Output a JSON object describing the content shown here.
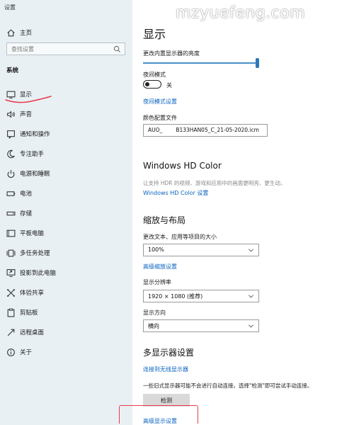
{
  "window": {
    "title": "设置"
  },
  "watermark": "mzyuefeng.com",
  "sidebar": {
    "home": "主页",
    "search_placeholder": "查找设置",
    "section": "系统",
    "items": [
      {
        "label": "显示",
        "icon": "monitor-icon"
      },
      {
        "label": "声音",
        "icon": "speaker-icon"
      },
      {
        "label": "通知和操作",
        "icon": "notification-icon"
      },
      {
        "label": "专注助手",
        "icon": "moon-icon"
      },
      {
        "label": "电源和睡眠",
        "icon": "power-icon"
      },
      {
        "label": "电池",
        "icon": "battery-icon"
      },
      {
        "label": "存储",
        "icon": "storage-icon"
      },
      {
        "label": "平板电脑",
        "icon": "tablet-icon"
      },
      {
        "label": "多任务处理",
        "icon": "multitask-icon"
      },
      {
        "label": "投影到此电脑",
        "icon": "project-icon"
      },
      {
        "label": "体验共享",
        "icon": "share-icon"
      },
      {
        "label": "剪贴板",
        "icon": "clipboard-icon"
      },
      {
        "label": "远程桌面",
        "icon": "remote-desktop-icon"
      },
      {
        "label": "关于",
        "icon": "info-icon"
      }
    ]
  },
  "main": {
    "title": "显示",
    "brightness_label": "更改内置显示器的亮度",
    "brightness_value": 100,
    "night_mode_label": "夜间模式",
    "night_mode_state": "关",
    "night_mode_settings_link": "夜间模式设置",
    "color_profile_label": "颜色配置文件",
    "color_profile_value": "AUO_        B133HAN05_C_21-05-2020.icm",
    "hd_title": "Windows HD Color",
    "hd_desc": "让支持 HDR 的视频、游戏和应用中的画面更明亮、更生动。",
    "hd_link": "Windows HD Color 设置",
    "scale_title": "缩放与布局",
    "scale_label": "更改文本、应用等项目的大小",
    "scale_value": "100%",
    "advanced_scale_link": "高级缩放设置",
    "resolution_label": "显示分辨率",
    "resolution_value": "1920 × 1080 (推荐)",
    "orientation_label": "显示方向",
    "orientation_value": "横向",
    "multi_title": "多显示器设置",
    "wireless_link": "连接到无线显示器",
    "multi_desc": "一些旧式显示器可能不会进行自动连接。选择\"检测\"即可尝试手动连接。",
    "detect_button": "检测",
    "advanced_display_link": "高级显示设置"
  },
  "colors": {
    "accent": "#0a63bf",
    "sidebar_bg": "#e9f0f4",
    "annotation": "#e83a4a"
  }
}
